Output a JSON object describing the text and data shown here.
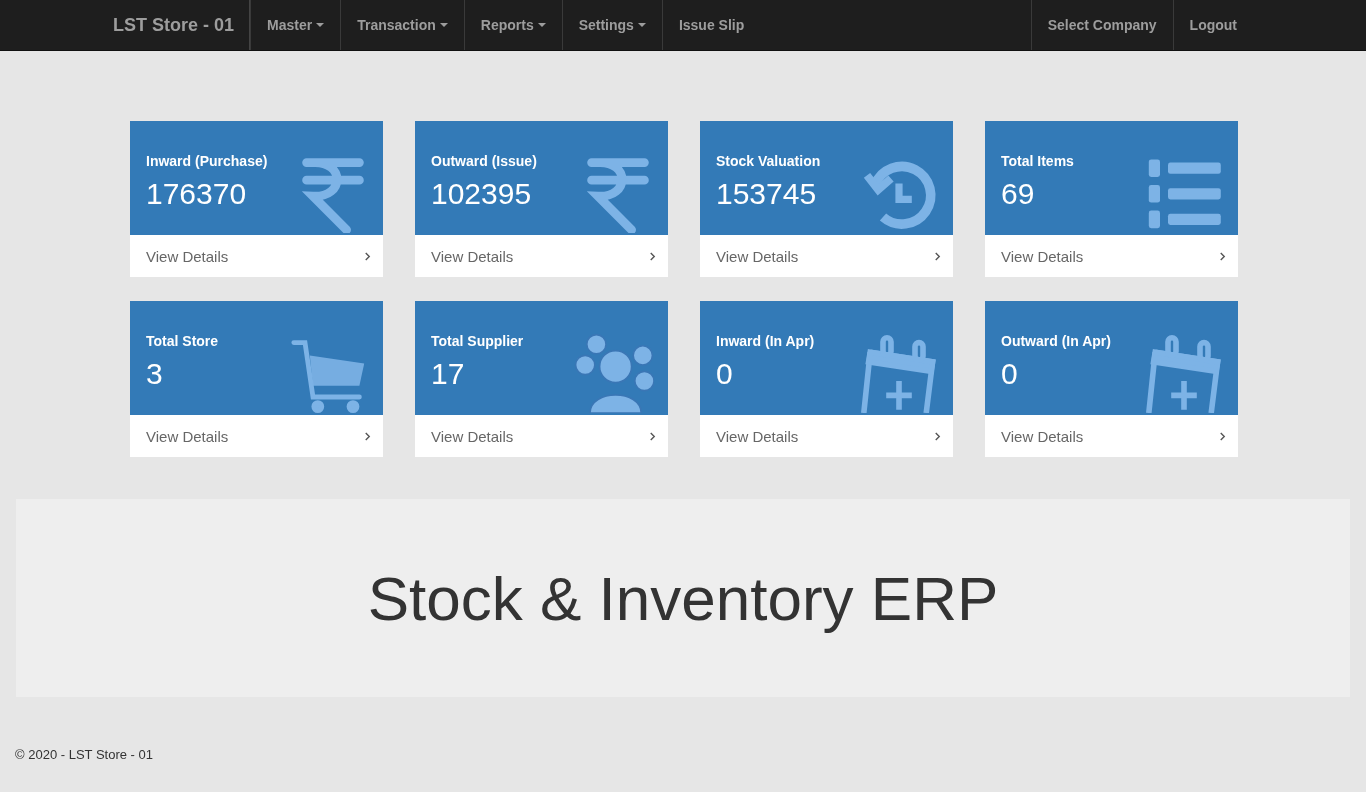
{
  "navbar": {
    "brand": "LST Store - 01",
    "menu": [
      {
        "label": "Master",
        "has_menu": true
      },
      {
        "label": "Transaction",
        "has_menu": true
      },
      {
        "label": "Reports",
        "has_menu": true
      },
      {
        "label": "Settings",
        "has_menu": true
      },
      {
        "label": "Issue Slip",
        "has_menu": false
      }
    ],
    "right_menu": [
      {
        "label": "Select Company"
      },
      {
        "label": "Logout"
      }
    ]
  },
  "cards": [
    {
      "title": "Inward (Purchase)",
      "value": "176370",
      "kind": "rupee",
      "link": "View Details"
    },
    {
      "title": "Outward (Issue)",
      "value": "102395",
      "kind": "rupee",
      "link": "View Details"
    },
    {
      "title": "Stock Valuation",
      "value": "153745",
      "kind": "history",
      "link": "View Details"
    },
    {
      "title": "Total Items",
      "value": "69",
      "kind": "list",
      "link": "View Details"
    },
    {
      "title": "Total Store",
      "value": "3",
      "kind": "cart",
      "link": "View Details"
    },
    {
      "title": "Total Supplier",
      "value": "17",
      "kind": "users",
      "link": "View Details"
    },
    {
      "title": "Inward (In Apr)",
      "value": "0",
      "kind": "calendar",
      "link": "View Details"
    },
    {
      "title": "Outward (In Apr)",
      "value": "0",
      "kind": "calendar",
      "link": "View Details"
    }
  ],
  "banner": {
    "heading": "Stock & Inventory ERP"
  },
  "footer": {
    "text": "© 2020 - LST Store - 01"
  }
}
